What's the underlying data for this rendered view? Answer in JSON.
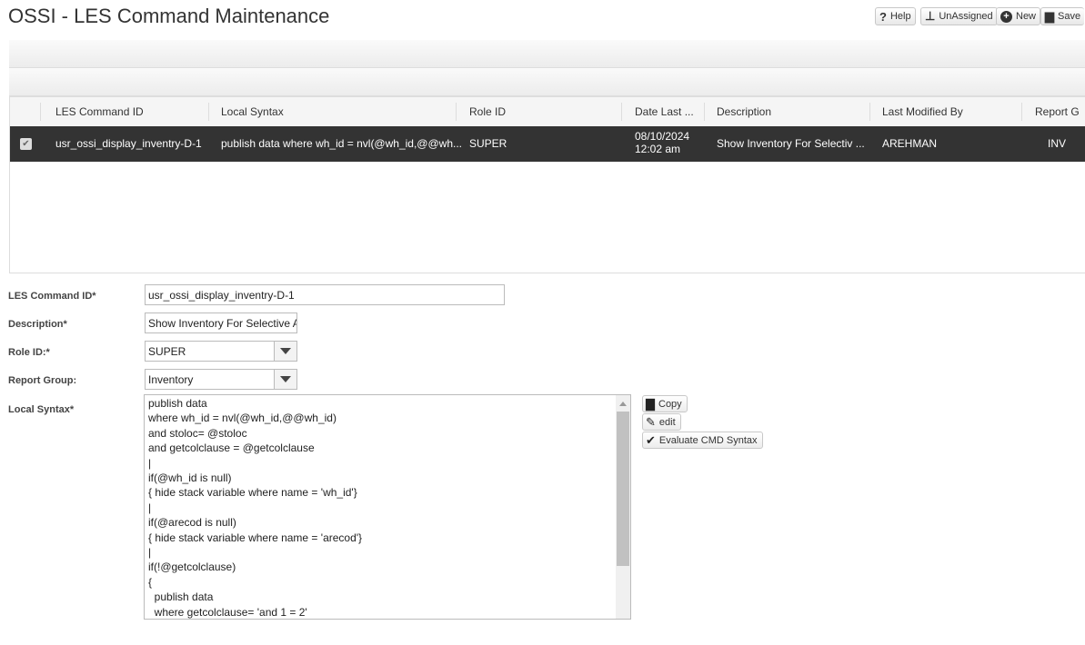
{
  "title": "OSSI - LES Command Maintenance",
  "toolbar": {
    "help": "Help",
    "unassigned": "UnAssigned",
    "new": "New",
    "save": "Save"
  },
  "grid": {
    "headers": [
      "LES Command ID",
      "Local Syntax",
      "Role ID",
      "Date Last ...",
      "Description",
      "Last Modified By",
      "Report G"
    ],
    "row": {
      "id": "usr_ossi_display_inventry-D-1",
      "syntax": "publish data where wh_id = nvl(@wh_id,@@wh...",
      "role": "SUPER",
      "date": "08/10/2024",
      "time": "12:02 am",
      "description": "Show Inventory For Selectiv ...",
      "modified_by": "AREHMAN",
      "report_group": "INV"
    }
  },
  "form": {
    "id_label": "LES Command ID*",
    "id_value": "usr_ossi_display_inventry-D-1",
    "desc_label": "Description*",
    "desc_value": "Show Inventory For Selective Are",
    "role_label": "Role ID:*",
    "role_value": "SUPER",
    "group_label": "Report Group:",
    "group_value": "Inventory",
    "syntax_label": "Local Syntax*",
    "syntax_lines": [
      "publish data",
      "where wh_id = nvl(@wh_id,@@wh_id)",
      "and stoloc= @stoloc",
      "and getcolclause = @getcolclause",
      "|",
      "if(@wh_id is null)",
      "{ hide stack variable where name = 'wh_id'}",
      "|",
      "if(@arecod is null)",
      "{ hide stack variable where name = 'arecod'}",
      "|",
      "if(!@getcolclause)",
      "{",
      "  publish data",
      "  where getcolclause= 'and 1 = 2'"
    ]
  },
  "actions": {
    "copy": "Copy",
    "edit": "edit",
    "evaluate": "Evaluate CMD Syntax"
  }
}
